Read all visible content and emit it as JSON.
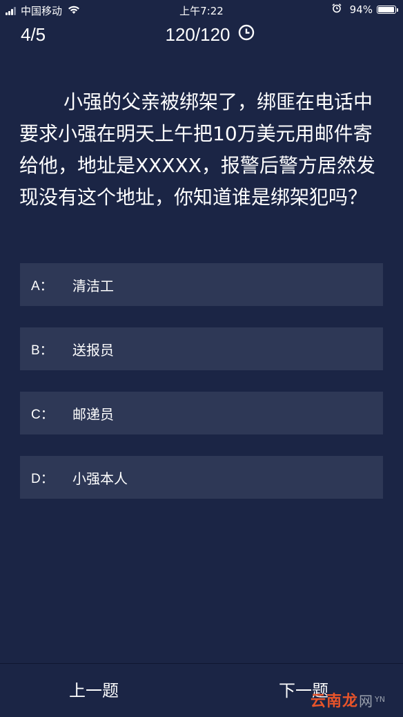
{
  "status_bar": {
    "carrier": "中国移动",
    "time": "上午7:22",
    "battery_percent": "94%",
    "battery_level": 0.94,
    "icons": [
      "signal-icon",
      "wifi-icon",
      "alarm-icon",
      "battery-icon"
    ]
  },
  "header": {
    "progress": "4/5",
    "timer": "120/120",
    "timer_icon": "clock-icon"
  },
  "question": {
    "text": "小强的父亲被绑架了，绑匪在电话中要求小强在明天上午把10万美元用邮件寄给他，地址是XXXXX，报警后警方居然发现没有这个地址，你知道谁是绑架犯吗？"
  },
  "options": [
    {
      "letter": "A：",
      "text": "清洁工"
    },
    {
      "letter": "B：",
      "text": "送报员"
    },
    {
      "letter": "C：",
      "text": "邮递员"
    },
    {
      "letter": "D：",
      "text": "小强本人"
    }
  ],
  "footer": {
    "prev_label": "上一题",
    "next_label": "下一题"
  },
  "watermark": {
    "brand": "云南龙",
    "suffix": "网",
    "small": "YN"
  },
  "colors": {
    "background": "#1b2545",
    "option_bg": "#2e3856",
    "text": "#ffffff",
    "watermark_accent": "#e8542a"
  }
}
